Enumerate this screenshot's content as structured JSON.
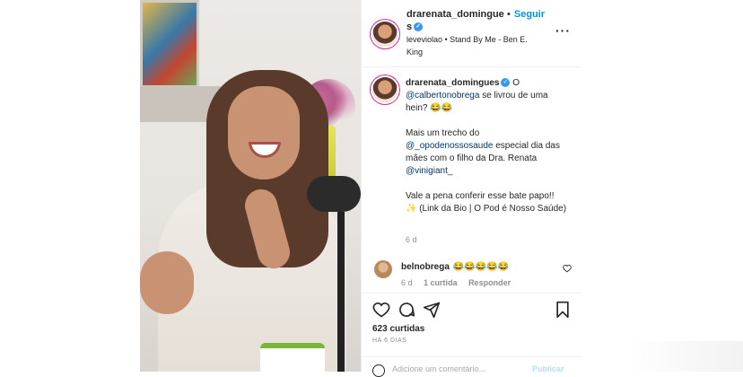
{
  "header": {
    "username": "drarenata_domingues",
    "follow_label": "Seguir",
    "audio": "leveviolao • Stand By Me - Ben E. King"
  },
  "caption": {
    "username": "drarenata_domingues",
    "line1_pre": "O",
    "mention1": "@calbertonobrega",
    "line1_post": "se livrou de uma hein? 😂😂",
    "line2_pre": "Mais um trecho do",
    "mention2": "@_opodenossosaude",
    "line2_post": "especial dia das mães com o filho da Dra. Renata",
    "mention3": "@vinigiant_",
    "line3": "Vale a pena conferir esse bate papo!!",
    "line4": "✨ (Link da Bio | O Pod é Nosso Saúde)",
    "time": "6 d"
  },
  "comment": {
    "username": "belnobrega",
    "text": "😂😂😂😂😂",
    "time": "6 d",
    "likes": "1 curtida",
    "reply": "Responder"
  },
  "actions": {
    "likes": "623 curtidas",
    "ago": "HÁ 6 DIAS"
  },
  "add_comment": {
    "placeholder": "Adicione um comentário...",
    "post": "Publicar"
  },
  "icons": [
    "verified-icon",
    "more-icon",
    "heart-icon",
    "comment-icon",
    "share-icon",
    "bookmark-icon",
    "emoji-icon"
  ],
  "colors": {
    "link": "#00376b",
    "accent": "#0095f6",
    "verified": "#3897f0"
  }
}
